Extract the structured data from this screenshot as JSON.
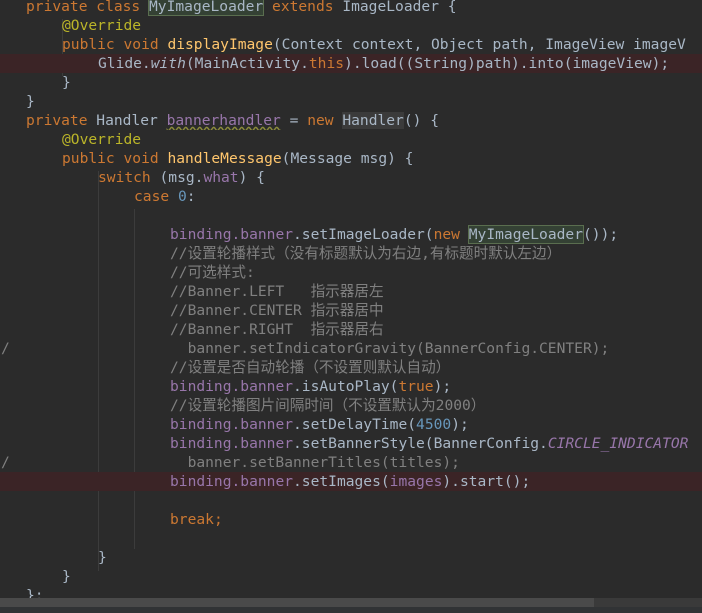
{
  "code": {
    "l1": {
      "a": "private class ",
      "b": "MyImageLoader",
      "c": " extends ",
      "d": "ImageLoader {"
    },
    "l2": {
      "a": "@Override"
    },
    "l3": {
      "a": "public void ",
      "b": "displayImage",
      "c": "(Context context, Object path, ImageView imageV"
    },
    "l4": {
      "a": "Glide.",
      "b": "with",
      "c": "(MainActivity.",
      "d": "this",
      "e": ").load((String)path).into(imageView);"
    },
    "l5": {
      "a": "}"
    },
    "l6": {
      "a": "}"
    },
    "l7": {
      "a": "private ",
      "b": "Handler ",
      "c": "bannerhandler",
      "d": " = ",
      "e": "new ",
      "f": "Handler",
      "g": "() {"
    },
    "l8": {
      "a": "@Override"
    },
    "l9": {
      "a": "public void ",
      "b": "handleMessage",
      "c": "(Message msg) {"
    },
    "l10": {
      "a": "switch ",
      "b": "(msg.",
      "c": "what",
      "d": ") {"
    },
    "l11": {
      "a": "case ",
      "b": "0",
      "c": ":"
    },
    "l13": {
      "a": "binding.",
      "b": "banner",
      "c": ".setImageLoader(",
      "d": "new ",
      "e": "MyImageLoader",
      "f": "());"
    },
    "l14": {
      "a": "//设置轮播样式（没有标题默认为右边,有标题时默认左边）"
    },
    "l15": {
      "a": "//可选样式:"
    },
    "l16": {
      "a": "//Banner.LEFT   指示器居左"
    },
    "l17": {
      "a": "//Banner.CENTER 指示器居中"
    },
    "l18": {
      "a": "//Banner.RIGHT  指示器居右"
    },
    "l19": {
      "mark": "/",
      "a": "  banner.setIndicatorGravity(BannerConfig.CENTER);"
    },
    "l20": {
      "a": "//设置是否自动轮播（不设置则默认自动）"
    },
    "l21": {
      "a": "binding.",
      "b": "banner",
      "c": ".isAutoPlay(",
      "d": "true",
      "e": ");"
    },
    "l22": {
      "a": "//设置轮播图片间隔时间（不设置默认为2000）"
    },
    "l23": {
      "a": "binding.",
      "b": "banner",
      "c": ".setDelayTime(",
      "d": "4500",
      "e": ");"
    },
    "l24": {
      "a": "binding.",
      "b": "banner",
      "c": ".setBannerStyle(BannerConfig.",
      "d": "CIRCLE_INDICATOR"
    },
    "l25": {
      "mark": "/",
      "a": "  banner.setBannerTitles(titles);"
    },
    "l26": {
      "a": "binding.",
      "b": "banner",
      "c": ".setImages(",
      "d": "images",
      "e": ").start();"
    },
    "l28": {
      "a": "break",
      "b": ";"
    },
    "l30": {
      "a": "}"
    },
    "l31": {
      "a": "}"
    },
    "l32": {
      "a": "};"
    }
  },
  "colors": {
    "background": "#2b2b2b",
    "keyword": "#cc7832",
    "annotation": "#bbb529",
    "method": "#ffc66d",
    "field": "#9876aa",
    "number": "#6897bb",
    "comment": "#808080",
    "text": "#a9b7c6",
    "error_line": "#3b2426"
  }
}
